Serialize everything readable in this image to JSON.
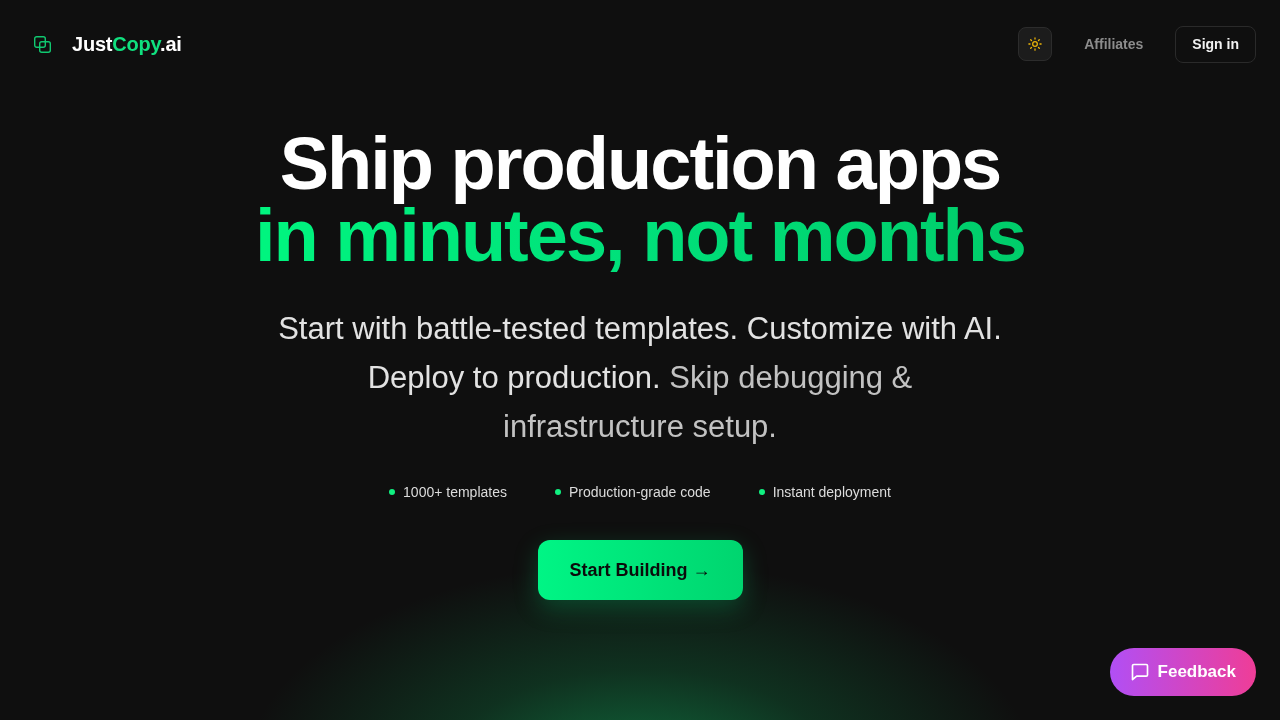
{
  "header": {
    "logo": {
      "prefix": "Just",
      "accent": "Copy",
      "suffix": ".ai"
    },
    "nav": [
      {
        "kind": "theme"
      },
      {
        "kind": "link",
        "label": "Affiliates"
      },
      {
        "kind": "outline",
        "label": "Sign in"
      }
    ]
  },
  "hero": {
    "title_line1": "Ship production apps",
    "title_line2": "in minutes, not months",
    "subtitle": {
      "lead": "Start with battle-tested templates. Customize with AI. Deploy to production.",
      "rest": "Skip debugging & infrastructure setup."
    },
    "features": [
      "1000+ templates",
      "Production-grade code",
      "Instant deployment"
    ],
    "cta": "Start Building →"
  },
  "feedback_button": "Feedback"
}
